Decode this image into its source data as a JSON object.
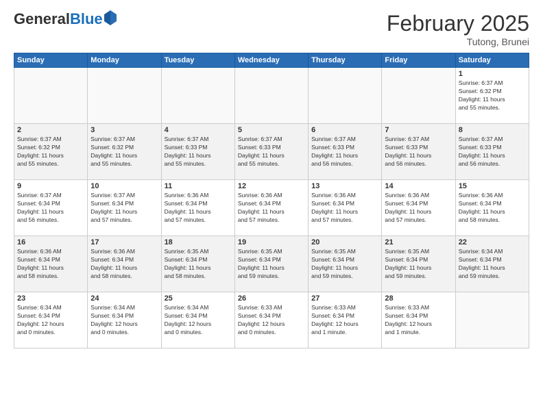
{
  "header": {
    "logo_general": "General",
    "logo_blue": "Blue",
    "title": "February 2025",
    "location": "Tutong, Brunei"
  },
  "days_of_week": [
    "Sunday",
    "Monday",
    "Tuesday",
    "Wednesday",
    "Thursday",
    "Friday",
    "Saturday"
  ],
  "weeks": [
    {
      "days": [
        {
          "num": "",
          "info": ""
        },
        {
          "num": "",
          "info": ""
        },
        {
          "num": "",
          "info": ""
        },
        {
          "num": "",
          "info": ""
        },
        {
          "num": "",
          "info": ""
        },
        {
          "num": "",
          "info": ""
        },
        {
          "num": "1",
          "info": "Sunrise: 6:37 AM\nSunset: 6:32 PM\nDaylight: 11 hours\nand 55 minutes."
        }
      ]
    },
    {
      "days": [
        {
          "num": "2",
          "info": "Sunrise: 6:37 AM\nSunset: 6:32 PM\nDaylight: 11 hours\nand 55 minutes."
        },
        {
          "num": "3",
          "info": "Sunrise: 6:37 AM\nSunset: 6:32 PM\nDaylight: 11 hours\nand 55 minutes."
        },
        {
          "num": "4",
          "info": "Sunrise: 6:37 AM\nSunset: 6:33 PM\nDaylight: 11 hours\nand 55 minutes."
        },
        {
          "num": "5",
          "info": "Sunrise: 6:37 AM\nSunset: 6:33 PM\nDaylight: 11 hours\nand 55 minutes."
        },
        {
          "num": "6",
          "info": "Sunrise: 6:37 AM\nSunset: 6:33 PM\nDaylight: 11 hours\nand 56 minutes."
        },
        {
          "num": "7",
          "info": "Sunrise: 6:37 AM\nSunset: 6:33 PM\nDaylight: 11 hours\nand 56 minutes."
        },
        {
          "num": "8",
          "info": "Sunrise: 6:37 AM\nSunset: 6:33 PM\nDaylight: 11 hours\nand 56 minutes."
        }
      ]
    },
    {
      "days": [
        {
          "num": "9",
          "info": "Sunrise: 6:37 AM\nSunset: 6:34 PM\nDaylight: 11 hours\nand 56 minutes."
        },
        {
          "num": "10",
          "info": "Sunrise: 6:37 AM\nSunset: 6:34 PM\nDaylight: 11 hours\nand 57 minutes."
        },
        {
          "num": "11",
          "info": "Sunrise: 6:36 AM\nSunset: 6:34 PM\nDaylight: 11 hours\nand 57 minutes."
        },
        {
          "num": "12",
          "info": "Sunrise: 6:36 AM\nSunset: 6:34 PM\nDaylight: 11 hours\nand 57 minutes."
        },
        {
          "num": "13",
          "info": "Sunrise: 6:36 AM\nSunset: 6:34 PM\nDaylight: 11 hours\nand 57 minutes."
        },
        {
          "num": "14",
          "info": "Sunrise: 6:36 AM\nSunset: 6:34 PM\nDaylight: 11 hours\nand 57 minutes."
        },
        {
          "num": "15",
          "info": "Sunrise: 6:36 AM\nSunset: 6:34 PM\nDaylight: 11 hours\nand 58 minutes."
        }
      ]
    },
    {
      "days": [
        {
          "num": "16",
          "info": "Sunrise: 6:36 AM\nSunset: 6:34 PM\nDaylight: 11 hours\nand 58 minutes."
        },
        {
          "num": "17",
          "info": "Sunrise: 6:36 AM\nSunset: 6:34 PM\nDaylight: 11 hours\nand 58 minutes."
        },
        {
          "num": "18",
          "info": "Sunrise: 6:35 AM\nSunset: 6:34 PM\nDaylight: 11 hours\nand 58 minutes."
        },
        {
          "num": "19",
          "info": "Sunrise: 6:35 AM\nSunset: 6:34 PM\nDaylight: 11 hours\nand 59 minutes."
        },
        {
          "num": "20",
          "info": "Sunrise: 6:35 AM\nSunset: 6:34 PM\nDaylight: 11 hours\nand 59 minutes."
        },
        {
          "num": "21",
          "info": "Sunrise: 6:35 AM\nSunset: 6:34 PM\nDaylight: 11 hours\nand 59 minutes."
        },
        {
          "num": "22",
          "info": "Sunrise: 6:34 AM\nSunset: 6:34 PM\nDaylight: 11 hours\nand 59 minutes."
        }
      ]
    },
    {
      "days": [
        {
          "num": "23",
          "info": "Sunrise: 6:34 AM\nSunset: 6:34 PM\nDaylight: 12 hours\nand 0 minutes."
        },
        {
          "num": "24",
          "info": "Sunrise: 6:34 AM\nSunset: 6:34 PM\nDaylight: 12 hours\nand 0 minutes."
        },
        {
          "num": "25",
          "info": "Sunrise: 6:34 AM\nSunset: 6:34 PM\nDaylight: 12 hours\nand 0 minutes."
        },
        {
          "num": "26",
          "info": "Sunrise: 6:33 AM\nSunset: 6:34 PM\nDaylight: 12 hours\nand 0 minutes."
        },
        {
          "num": "27",
          "info": "Sunrise: 6:33 AM\nSunset: 6:34 PM\nDaylight: 12 hours\nand 1 minute."
        },
        {
          "num": "28",
          "info": "Sunrise: 6:33 AM\nSunset: 6:34 PM\nDaylight: 12 hours\nand 1 minute."
        },
        {
          "num": "",
          "info": ""
        }
      ]
    }
  ]
}
